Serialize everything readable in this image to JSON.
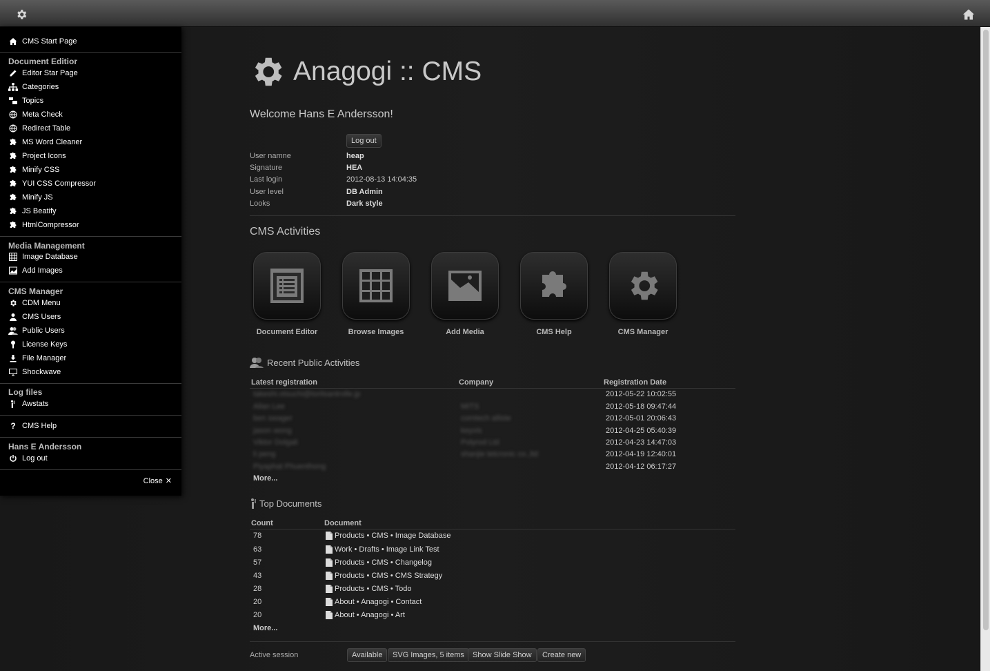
{
  "sidebar": {
    "start": "CMS Start Page",
    "doc_head": "Document Editior",
    "doc_items": [
      "Editor Star Page",
      "Categories",
      "Topics",
      "Meta Check",
      "Redirect Table",
      "MS Word Cleaner",
      "Project Icons",
      "Minify CSS",
      "YUI CSS Compressor",
      "Minify JS",
      "JS Beatify",
      "HtmlCompressor"
    ],
    "media_head": "Media Management",
    "media_items": [
      "Image Database",
      "Add Images"
    ],
    "cms_head": "CMS Manager",
    "cms_items": [
      "CDM Menu",
      "CMS Users",
      "Public Users",
      "License Keys",
      "File Manager",
      "Shockwave"
    ],
    "log_head": "Log files",
    "log_items": [
      "Awstats"
    ],
    "help": "CMS Help",
    "user_head": "Hans E Andersson",
    "logout": "Log out",
    "close": "Close"
  },
  "header": {
    "title": "Anagogi :: CMS",
    "welcome": "Welcome Hans E Andersson!",
    "logout_button": "Log out"
  },
  "user_info": {
    "labels": [
      "User namne",
      "Signature",
      "Last login",
      "User level",
      "Looks"
    ],
    "values": [
      "heap",
      "HEA",
      "2012-08-13 14:04:35",
      "DB Admin",
      "Dark style"
    ]
  },
  "activities": {
    "title": "CMS Activities",
    "items": [
      "Document Editor",
      "Browse Images",
      "Add Media",
      "CMS Help",
      "CMS Manager"
    ]
  },
  "recent": {
    "title": "Recent Public Activities",
    "headers": [
      "Latest registration",
      "Company",
      "Registration Date"
    ],
    "rows": [
      {
        "name": "takeshi.otsuchi@toritsantrolle.jp",
        "company": "",
        "date": "2012-05-22 10:02:55"
      },
      {
        "name": "Allan Lee",
        "company": "MITS",
        "date": "2012-05-18 09:47:44"
      },
      {
        "name": "ben swager",
        "company": "comtech alliste",
        "date": "2012-05-01 20:06:43"
      },
      {
        "name": "jason wong",
        "company": "keyvis",
        "date": "2012-04-25 05:40:39"
      },
      {
        "name": "Viktor Dolgali",
        "company": "Polyrod Ltd",
        "date": "2012-04-23 14:47:03"
      },
      {
        "name": "li peng",
        "company": "shanjie tetcronic co.,ltd",
        "date": "2012-04-19 12:40:01"
      },
      {
        "name": "Piyaphat Phuenthong",
        "company": "",
        "date": "2012-04-12 06:17:27"
      }
    ],
    "more": "More..."
  },
  "top_docs": {
    "title": "Top Documents",
    "headers": [
      "Count",
      "Document"
    ],
    "rows": [
      {
        "count": "78",
        "doc": "Products • CMS • Image Database"
      },
      {
        "count": "63",
        "doc": "Work • Drafts • Image Link Test"
      },
      {
        "count": "57",
        "doc": "Products • CMS • Changelog"
      },
      {
        "count": "43",
        "doc": "Products • CMS • CMS Strategy"
      },
      {
        "count": "28",
        "doc": "Products • CMS • Todo"
      },
      {
        "count": "20",
        "doc": "About • Anagogi • Contact"
      },
      {
        "count": "20",
        "doc": "About • Anagogi • Art"
      }
    ],
    "more": "More..."
  },
  "session": {
    "label": "Active session",
    "buttons": [
      "Available",
      "SVG Images, 5 items",
      "Show Slide Show",
      "Create new"
    ]
  }
}
